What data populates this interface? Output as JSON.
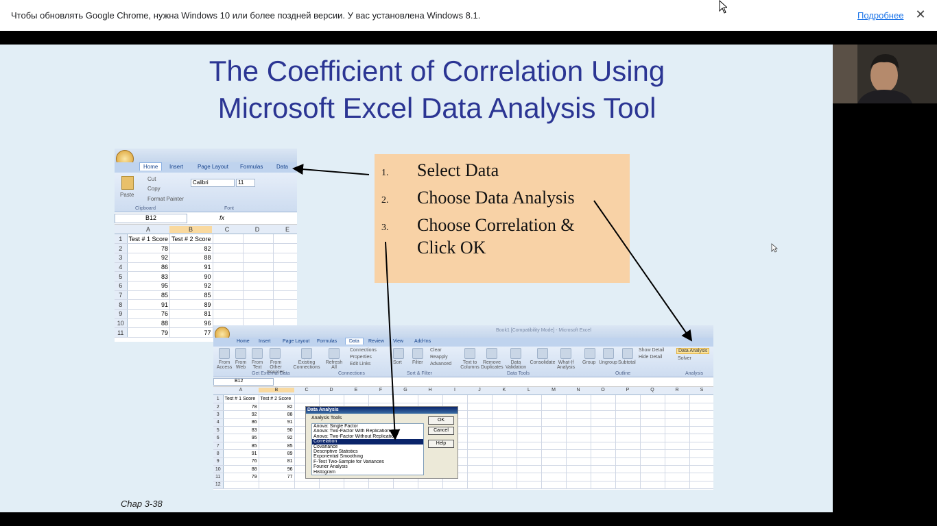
{
  "infobar": {
    "message": "Чтобы обновлять Google Chrome, нужна Windows 10 или более поздней версии. У вас установлена Windows 8.1.",
    "link": "Подробнее",
    "close": "✕"
  },
  "slide": {
    "title_line1": "The Coefficient of Correlation Using",
    "title_line2": "Microsoft Excel Data Analysis Tool",
    "steps": [
      {
        "num": "1.",
        "text": "Select Data"
      },
      {
        "num": "2.",
        "text": "Choose Data Analysis"
      },
      {
        "num": "3.",
        "text": "Choose Correlation &"
      },
      {
        "num": "",
        "text": "Click OK"
      }
    ],
    "footer": "Chap 3-38"
  },
  "excel_small": {
    "tabs": [
      "Home",
      "Insert",
      "Page Layout",
      "Formulas",
      "Data"
    ],
    "clipboard": {
      "paste": "Paste",
      "cut": "Cut",
      "copy": "Copy",
      "format_painter": "Format Painter",
      "group": "Clipboard"
    },
    "font": {
      "name": "Calibri",
      "size": "11",
      "group": "Font"
    },
    "name_box": "B12",
    "fx": "fx",
    "columns": [
      "A",
      "B",
      "C",
      "D",
      "E"
    ],
    "headers": [
      "Test # 1 Score",
      "Test # 2 Score"
    ],
    "rows": [
      [
        "78",
        "82"
      ],
      [
        "92",
        "88"
      ],
      [
        "86",
        "91"
      ],
      [
        "83",
        "90"
      ],
      [
        "95",
        "92"
      ],
      [
        "85",
        "85"
      ],
      [
        "91",
        "89"
      ],
      [
        "76",
        "81"
      ],
      [
        "88",
        "96"
      ],
      [
        "79",
        "77"
      ]
    ]
  },
  "excel_big": {
    "window_title": "Book1 [Compatibility Mode] - Microsoft Excel",
    "tabs": [
      "Home",
      "Insert",
      "Page Layout",
      "Formulas",
      "Data",
      "Review",
      "View",
      "Add-Ins"
    ],
    "groups": [
      "Get External Data",
      "Connections",
      "Sort & Filter",
      "Data Tools",
      "Outline",
      "Analysis"
    ],
    "external": [
      "From Access",
      "From Web",
      "From Text",
      "From Other Sources",
      "Existing Connections"
    ],
    "connections": [
      "Refresh All",
      "Connections",
      "Properties",
      "Edit Links"
    ],
    "sort": [
      "Sort",
      "Filter",
      "Clear",
      "Reapply",
      "Advanced"
    ],
    "tools": [
      "Text to Columns",
      "Remove Duplicates",
      "Data Validation",
      "Consolidate",
      "What-If Analysis"
    ],
    "outline": [
      "Group",
      "Ungroup",
      "Subtotal",
      "Show Detail",
      "Hide Detail"
    ],
    "analysis": [
      "Data Analysis",
      "Solver"
    ],
    "name_box": "B12",
    "columns": [
      "A",
      "B",
      "C",
      "D",
      "E",
      "F",
      "G",
      "H",
      "I",
      "J",
      "K",
      "L",
      "M",
      "N",
      "O",
      "P",
      "Q",
      "R",
      "S"
    ],
    "headers": [
      "Test # 1 Score",
      "Test # 2 Score"
    ],
    "rows": [
      [
        "78",
        "82"
      ],
      [
        "92",
        "88"
      ],
      [
        "86",
        "91"
      ],
      [
        "83",
        "90"
      ],
      [
        "95",
        "92"
      ],
      [
        "85",
        "85"
      ],
      [
        "91",
        "89"
      ],
      [
        "76",
        "81"
      ],
      [
        "88",
        "96"
      ],
      [
        "79",
        "77"
      ]
    ]
  },
  "dialog": {
    "title": "Data Analysis",
    "label": "Analysis Tools",
    "items": [
      "Anova: Single Factor",
      "Anova: Two-Factor With Replication",
      "Anova: Two-Factor Without Replication",
      "Correlation",
      "Covariance",
      "Descriptive Statistics",
      "Exponential Smoothing",
      "F-Test Two-Sample for Variances",
      "Fourier Analysis",
      "Histogram"
    ],
    "selected_index": 3,
    "ok": "OK",
    "cancel": "Cancel",
    "help": "Help"
  }
}
